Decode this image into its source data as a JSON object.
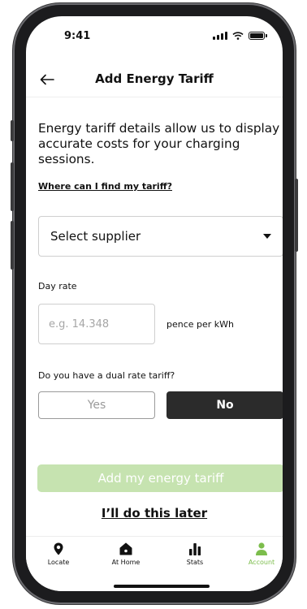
{
  "status_bar": {
    "time": "9:41"
  },
  "header": {
    "title": "Add Energy Tariff"
  },
  "intro": {
    "text": "Energy tariff details allow us to display accurate costs for your charging sessions.",
    "help_link": "Where can I find my tariff?"
  },
  "supplier": {
    "placeholder": "Select supplier"
  },
  "day_rate": {
    "label": "Day rate",
    "placeholder": "e.g. 14.348",
    "value": "",
    "unit": "pence per kWh"
  },
  "dual_rate": {
    "question": "Do you have a dual rate tariff?",
    "yes_label": "Yes",
    "no_label": "No",
    "selected": "No"
  },
  "actions": {
    "submit_label": "Add my energy tariff",
    "later_label": "I’ll do this later"
  },
  "tab_bar": {
    "items": [
      {
        "label": "Locate",
        "icon": "location-pin-icon"
      },
      {
        "label": "At Home",
        "icon": "home-icon"
      },
      {
        "label": "Stats",
        "icon": "bar-chart-icon"
      },
      {
        "label": "Account",
        "icon": "person-icon"
      }
    ],
    "active": "Account"
  },
  "colors": {
    "accent": "#7cbd4c",
    "button_disabled": "#c6e3b0",
    "selected_toggle": "#2b2b2b"
  }
}
